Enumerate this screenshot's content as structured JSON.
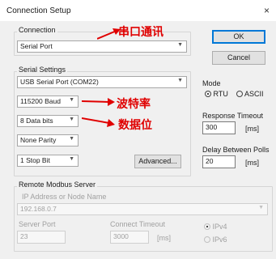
{
  "window": {
    "title": "Connection Setup",
    "close_symbol": "×"
  },
  "connection": {
    "legend": "Connection",
    "value": "Serial Port",
    "annotation": "串口通讯"
  },
  "buttons": {
    "ok": "OK",
    "cancel": "Cancel",
    "advanced": "Advanced..."
  },
  "serial": {
    "legend": "Serial Settings",
    "port": "USB Serial Port (COM22)",
    "baud": "115200 Baud",
    "databits": "8 Data bits",
    "parity": "None Parity",
    "stopbits": "1 Stop Bit",
    "annot_baud": "波特率",
    "annot_databits": "数据位"
  },
  "mode": {
    "label": "Mode",
    "rtu": "RTU",
    "ascii": "ASCII"
  },
  "response": {
    "label": "Response Timeout",
    "value": "300",
    "unit": "[ms]"
  },
  "delay": {
    "label": "Delay Between Polls",
    "value": "20",
    "unit": "[ms]"
  },
  "remote": {
    "legend": "Remote Modbus Server",
    "ip_label": "IP Address or Node Name",
    "ip_value": "192.168.0.7",
    "port_label": "Server Port",
    "port_value": "23",
    "timeout_label": "Connect Timeout",
    "timeout_value": "3000",
    "timeout_unit": "[ms]",
    "ipv4": "IPv4",
    "ipv6": "IPv6"
  },
  "colors": {
    "annotation": "#e00000",
    "accent": "#0078d7"
  }
}
